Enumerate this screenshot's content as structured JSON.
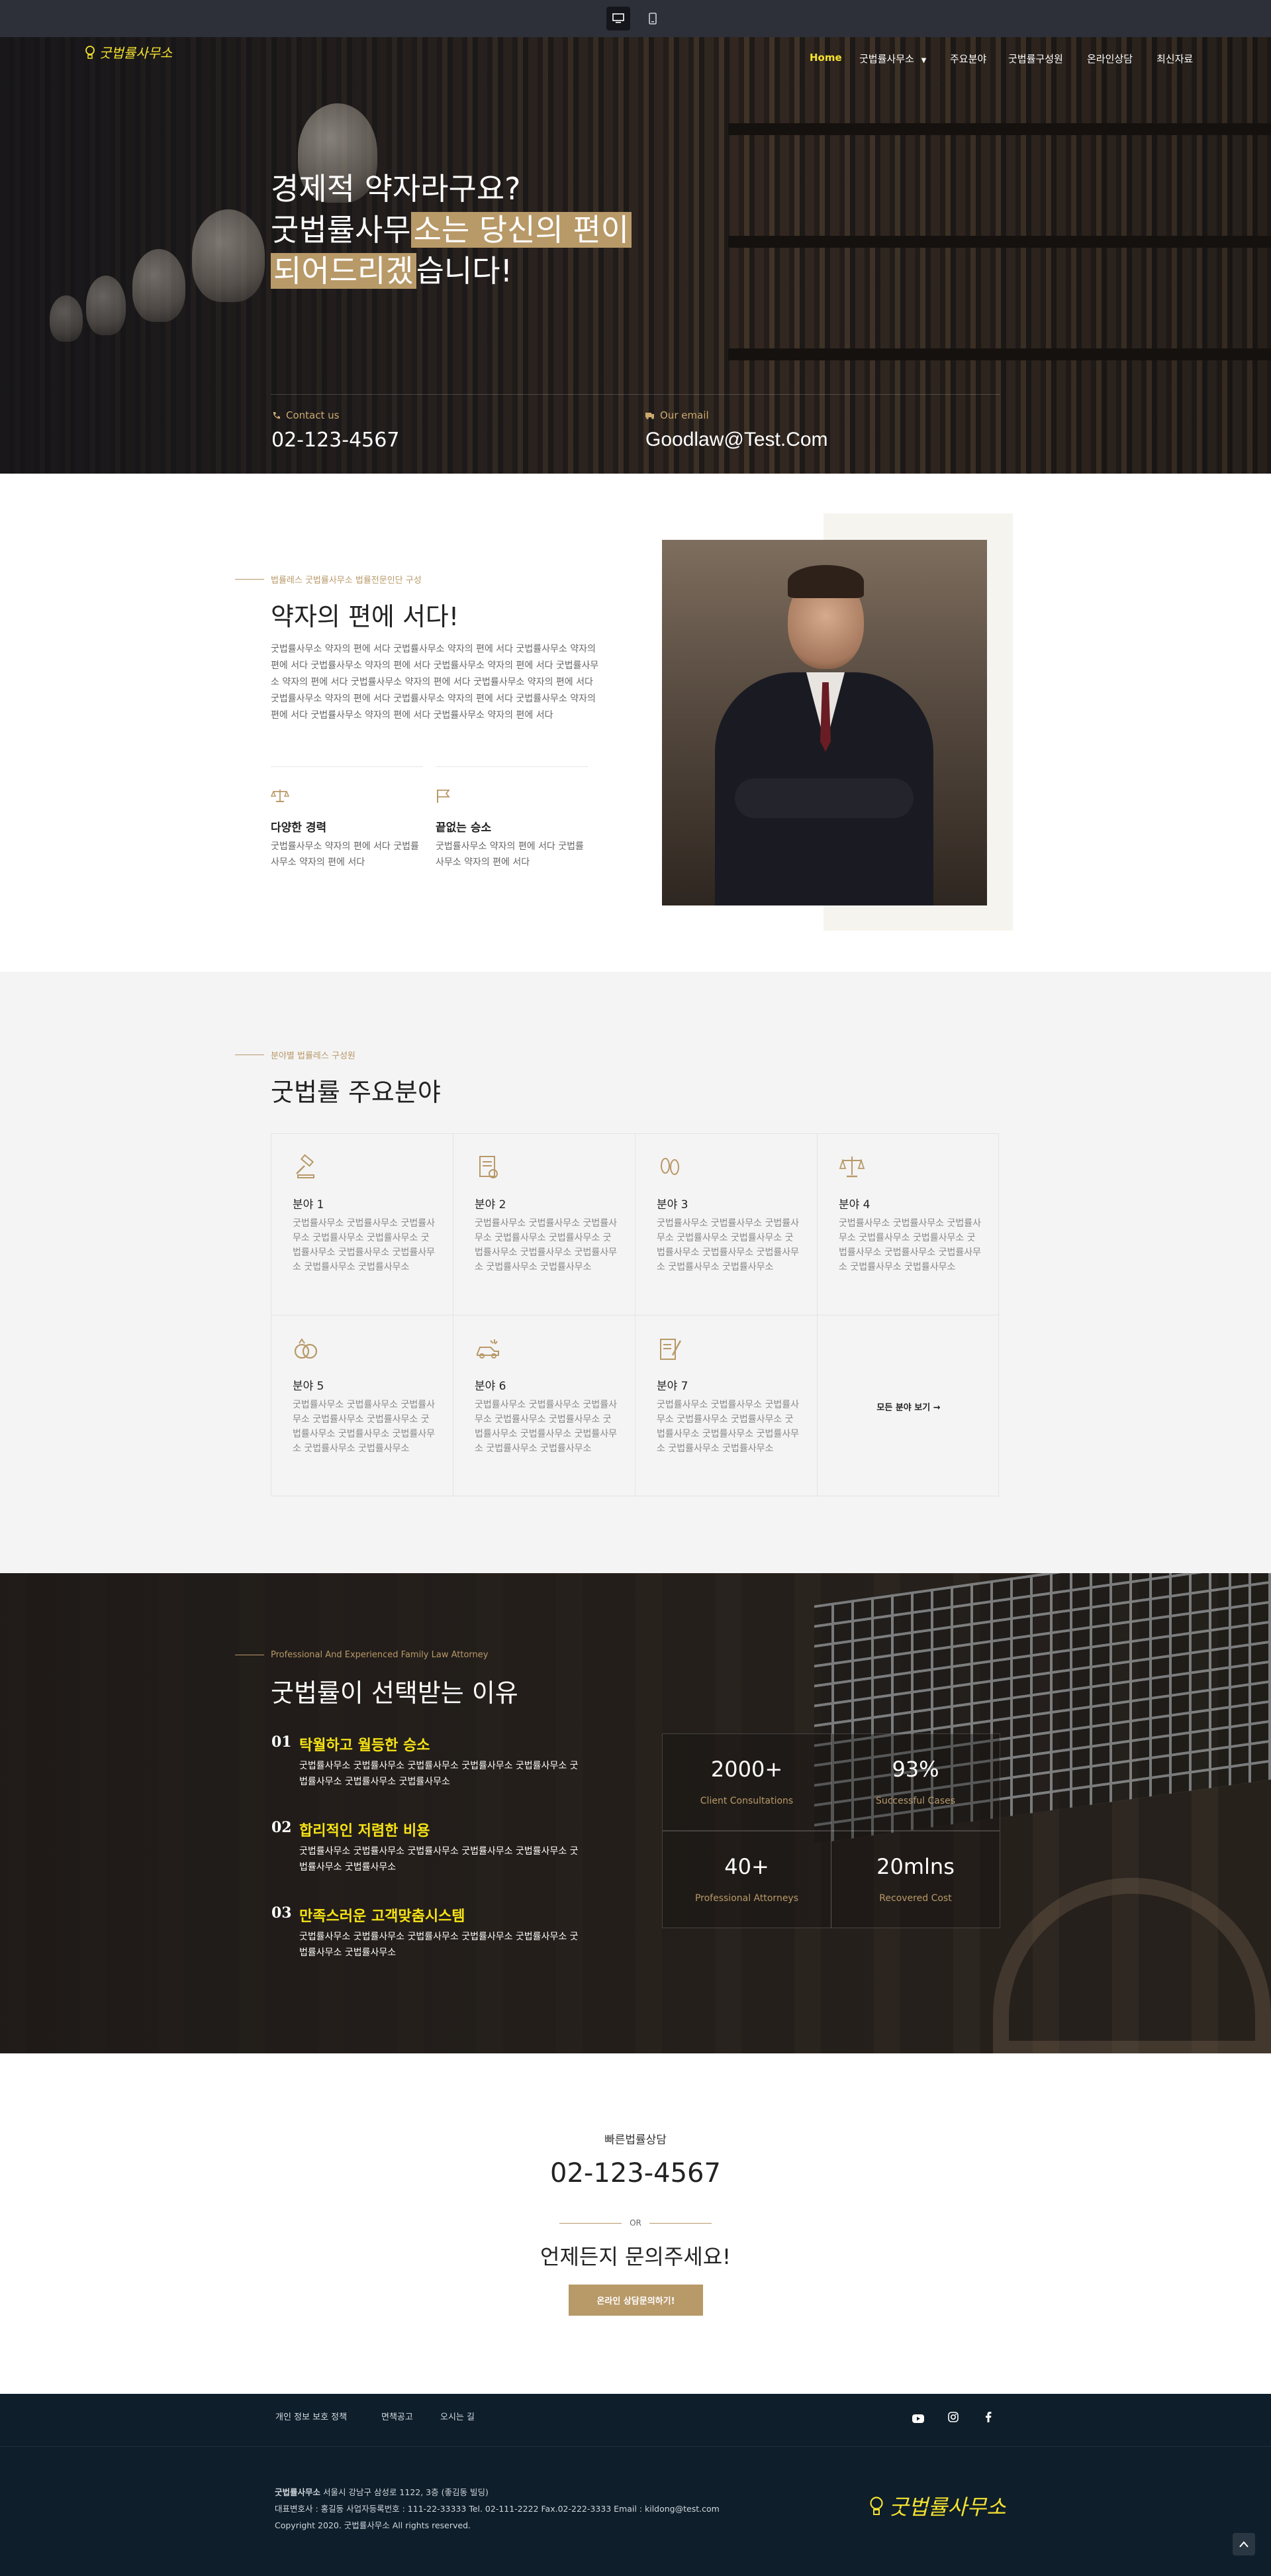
{
  "brand": {
    "logo_text": "굿법률사무소",
    "accent_color": "#b89968",
    "logo_color": "#f4e22f"
  },
  "device_bar": {
    "desktop_icon": "desktop-icon",
    "mobile_icon": "mobile-icon"
  },
  "nav": {
    "items": [
      "Home",
      "굿법률사무소",
      "주요분야",
      "굿법률구성원",
      "온라인상담",
      "최신자료"
    ],
    "active": "Home"
  },
  "hero": {
    "line1": "경제적 약자라구요?",
    "line2_a": "굿법률사무",
    "line2_b": "소는 당신의 편이",
    "line3_a": "되어드리겠",
    "line3_b": "습니다!",
    "contact_label": "Contact us",
    "contact_value": "02-123-4567",
    "email_label": "Our email",
    "email_value": "Goodlaw@Test.Com"
  },
  "about": {
    "eyebrow": "법률레스 굿법률사무소 법률전문인단 구성",
    "title": "약자의 편에 서다!",
    "body": "굿법률사무소 약자의 편에 서다 굿법률사무소 약자의 편에 서다 굿법률사무소 약자의 편에 서다 굿법률사무소 약자의 편에 서다 굿법률사무소 약자의 편에 서다 굿법률사무소 약자의 편에 서다 굿법률사무소 약자의 편에 서다 굿법률사무소 약자의 편에 서다 굿법률사무소 약자의 편에 서다 굿법률사무소 약자의 편에 서다 굿법률사무소 약자의 편에 서다 굿법률사무소 약자의 편에 서다 굿법률사무소 약자의 편에 서다",
    "features": [
      {
        "icon": "scales-icon",
        "title": "다양한 경력",
        "text": "굿법률사무소 약자의 편에 서다 굿법률사무소 약자의 편에 서다"
      },
      {
        "icon": "flag-icon",
        "title": "끝없는 승소",
        "text": "굿법률사무소 약자의 편에 서다 굿법률사무소 약자의 편에 서다"
      }
    ]
  },
  "practice": {
    "eyebrow": "분야별 법률레스 구성원",
    "title": "굿법률 주요분야",
    "cell_text": "굿법률사무소 굿법률사무소 굿법률사무소 굿법률사무소 굿법률사무소 굿법률사무소 굿법률사무소 굿법률사무소 굿법률사무소 굿법률사무소",
    "areas": [
      {
        "title": "분야 1",
        "icon": "gavel-icon"
      },
      {
        "title": "분야 2",
        "icon": "document-icon"
      },
      {
        "title": "분야 3",
        "icon": "footprints-icon"
      },
      {
        "title": "분야 4",
        "icon": "scales-icon"
      },
      {
        "title": "분야 5",
        "icon": "rings-icon"
      },
      {
        "title": "분야 6",
        "icon": "car-accident-icon"
      },
      {
        "title": "분야 7",
        "icon": "contract-icon"
      }
    ],
    "view_all": "모든 분야 보기 →"
  },
  "why": {
    "eyebrow": "Professional And Experienced Family Law Attorney",
    "title": "굿법률이 선택받는 이유",
    "reasons": [
      {
        "num": "01",
        "title": "탁월하고 월등한 승소",
        "text": "굿법률사무소 굿법률사무소 굿법률사무소 굿법률사무소 굿법률사무소 굿법률사무소 굿법률사무소 굿법률사무소"
      },
      {
        "num": "02",
        "title": "합리적인 저렴한 비용",
        "text": "굿법률사무소 굿법률사무소 굿법률사무소 굿법률사무소 굿법률사무소 굿법률사무소 굿법률사무소"
      },
      {
        "num": "03",
        "title": "만족스러운 고객맞춤시스템",
        "text": "굿법률사무소 굿법률사무소 굿법률사무소 굿법률사무소 굿법률사무소 굿법률사무소 굿법률사무소"
      }
    ],
    "stats": [
      {
        "value": "2000+",
        "label": "Client Consultations"
      },
      {
        "value": "93%",
        "label": "Successful Cases"
      },
      {
        "value": "40+",
        "label": "Professional Attorneys"
      },
      {
        "value": "20mlns",
        "label": "Recovered Cost"
      }
    ]
  },
  "consult": {
    "label": "빠른법률상담",
    "phone": "02-123-4567",
    "or": "OR",
    "cta_text": "언제든지 문의주세요!",
    "button": "온라인 상담문의하기!"
  },
  "footer": {
    "links": [
      "개인 정보 보호 정책",
      "면책공고",
      "오시는 길"
    ],
    "social": [
      "youtube-icon",
      "instagram-icon",
      "facebook-icon"
    ],
    "company_name": "굿법률사무소",
    "address": "서울시 강남구 삼성로 1122, 3층 (좋김동 빌딩)",
    "line2": "대표변호사 : 홍길동 사업자등록번호 : 111-22-33333 Tel. 02-111-2222 Fax.02-222-3333 Email : kildong@test.com",
    "copyright": "Copyright 2020. 굿법률사무소 All rights reserved."
  }
}
